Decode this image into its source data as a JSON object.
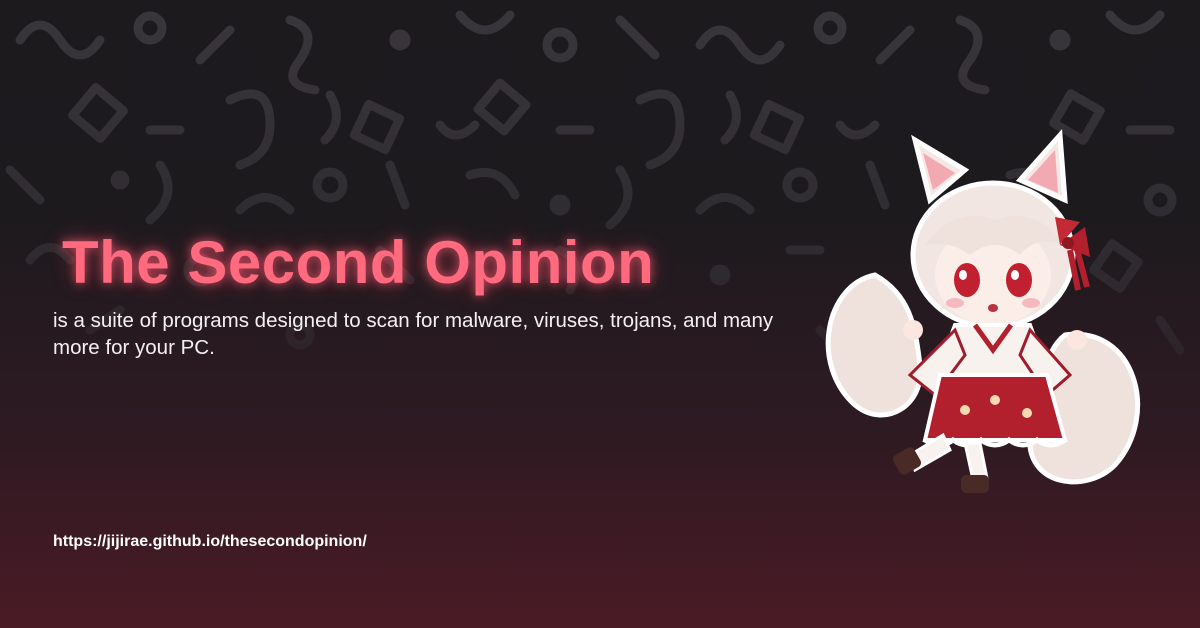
{
  "hero": {
    "title": "The Second Opinion",
    "subtitle": "is a suite of programs designed to scan for malware, viruses, trojans, and many more for your PC.",
    "url": "https://jijirae.github.io/thesecondopinion/"
  },
  "colors": {
    "background_top": "#1c1a1d",
    "background_bottom": "#4a1b25",
    "title": "#ff6a7f",
    "text": "#f4f0f2",
    "pattern": "#3a373c"
  },
  "images": {
    "mascot": "chibi-fox-girl-shrine-maiden",
    "background": "doodle-shapes-pattern"
  }
}
